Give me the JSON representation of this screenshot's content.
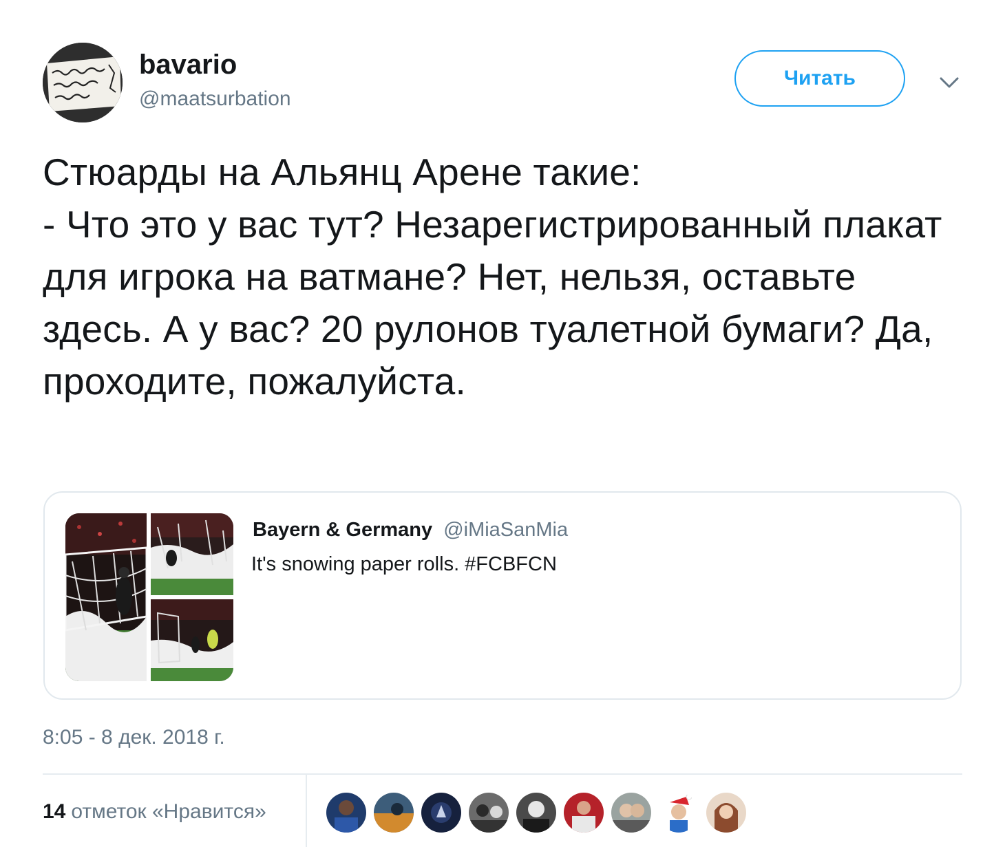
{
  "tweet": {
    "author": {
      "display_name": "bavario",
      "handle": "@maatsurbation",
      "avatar_icon": "handwritten-sign-avatar"
    },
    "follow_label": "Читать",
    "menu_icon": "chevron-down-icon",
    "text": "Стюарды на Альянц Арене такие:\n- Что это у вас тут? Незарегистрированный плакат для игрока на ватмане? Нет, нельзя, оставьте здесь. А у вас? 20 рулонов туалетной бумаги? Да, проходите, пожалуйста.",
    "timestamp": "8:05 - 8 дек. 2018 г.",
    "likes": {
      "count": "14",
      "label": "отметок «Нравится»"
    }
  },
  "quoted_tweet": {
    "author_name": "Bayern & Germany",
    "author_handle": "@iMiaSanMia",
    "text": "It's snowing paper rolls.  #FCBFCN",
    "media_count": 3
  },
  "likers": [
    {
      "name": "liker-1-avatar",
      "color": "#1f3b6b"
    },
    {
      "name": "liker-2-avatar",
      "color": "#3d5d7a"
    },
    {
      "name": "liker-3-avatar",
      "color": "#16213d"
    },
    {
      "name": "liker-4-avatar",
      "color": "#6b6b6b"
    },
    {
      "name": "liker-5-avatar",
      "color": "#4a4a4a"
    },
    {
      "name": "liker-6-avatar",
      "color": "#b5222a"
    },
    {
      "name": "liker-7-avatar",
      "color": "#9aa3a0"
    },
    {
      "name": "liker-8-avatar",
      "color": "#e9e3d9"
    },
    {
      "name": "liker-9-avatar",
      "color": "#8c4b2e"
    }
  ],
  "colors": {
    "accent": "#1da1f2",
    "secondary_text": "#657786",
    "border": "#e1e8ed"
  }
}
